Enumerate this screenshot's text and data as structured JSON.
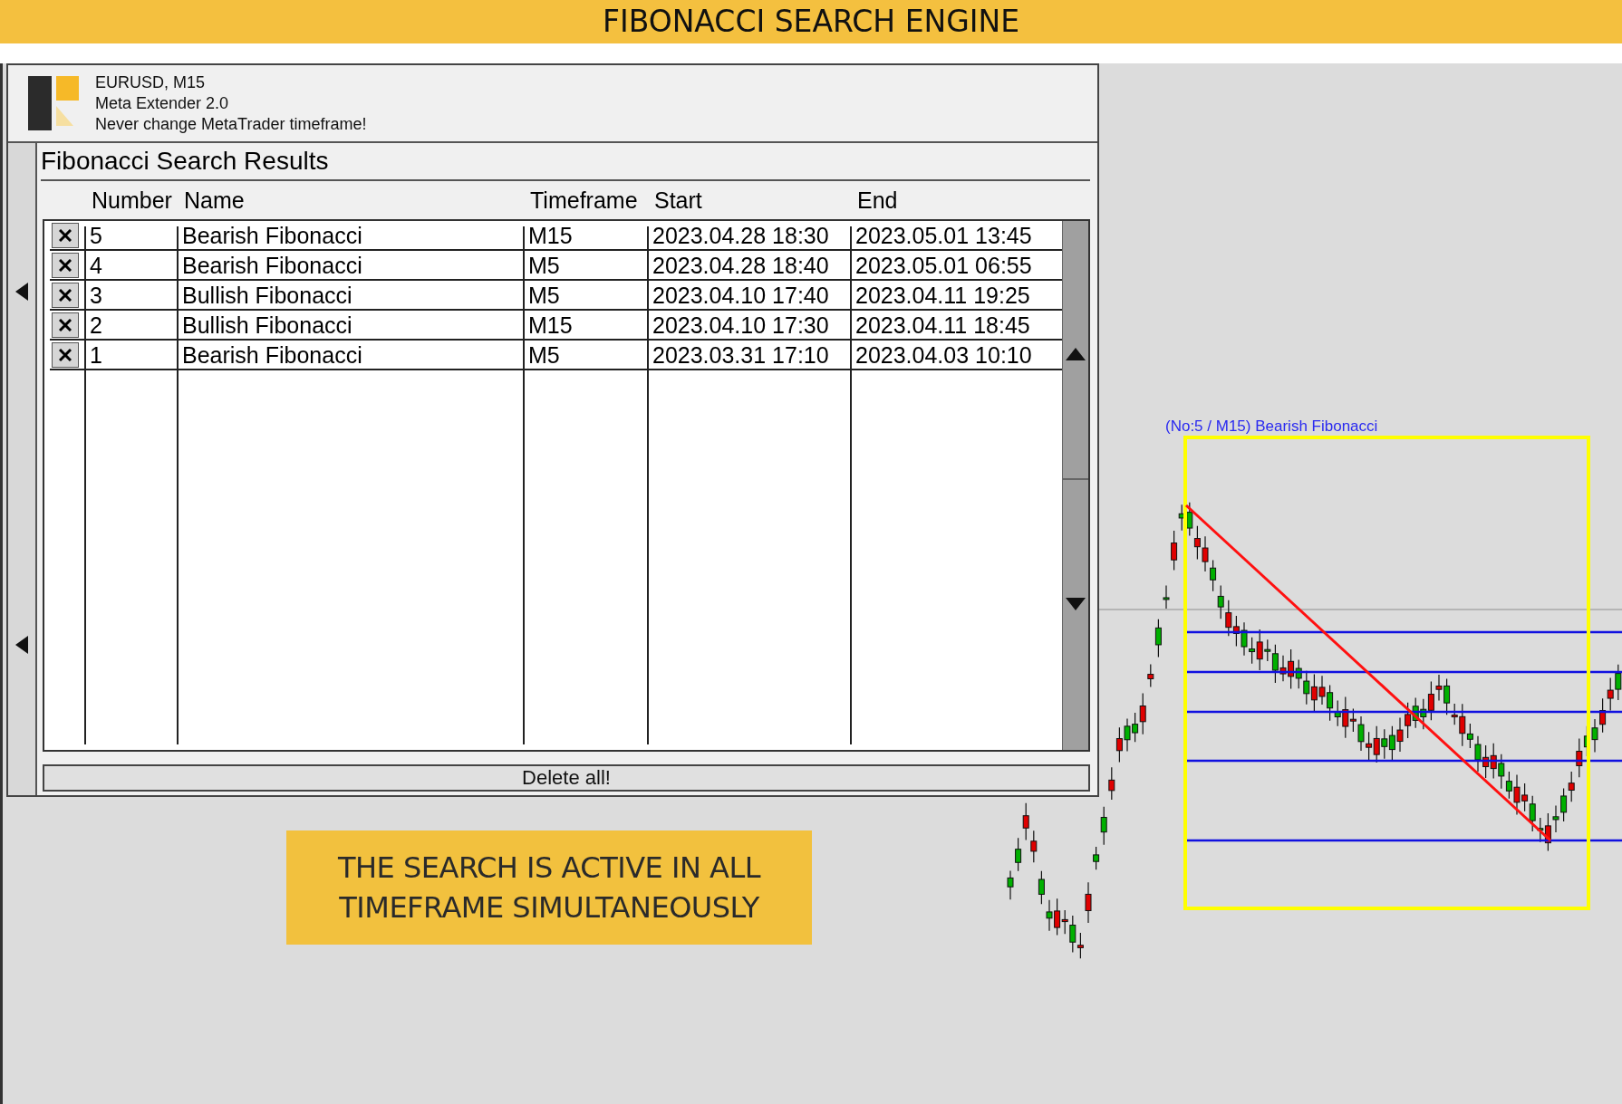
{
  "banner": {
    "title": "FIBONACCI SEARCH ENGINE"
  },
  "panel": {
    "symbol": "EURUSD, M15",
    "product": "Meta Extender 2.0",
    "notice": "Never change MetaTrader timeframe!",
    "title": "Fibonacci Search Results",
    "columns": [
      "Number",
      "Name",
      "Timeframe",
      "Start",
      "End"
    ],
    "rows": [
      {
        "number": "5",
        "name": "Bearish Fibonacci",
        "timeframe": "M15",
        "start": "2023.04.28 18:30",
        "end": "2023.05.01 13:45"
      },
      {
        "number": "4",
        "name": "Bearish Fibonacci",
        "timeframe": "M5",
        "start": "2023.04.28 18:40",
        "end": "2023.05.01 06:55"
      },
      {
        "number": "3",
        "name": "Bullish Fibonacci",
        "timeframe": "M5",
        "start": "2023.04.10 17:40",
        "end": "2023.04.11 19:25"
      },
      {
        "number": "2",
        "name": "Bullish Fibonacci",
        "timeframe": "M15",
        "start": "2023.04.10 17:30",
        "end": "2023.04.11 18:45"
      },
      {
        "number": "1",
        "name": "Bearish Fibonacci",
        "timeframe": "M5",
        "start": "2023.03.31 17:10",
        "end": "2023.04.03 10:10"
      }
    ],
    "delete_all": "Delete all!"
  },
  "chart": {
    "pattern_label": "(No:5 / M15) Bearish Fibonacci"
  },
  "callout": {
    "lines": [
      "THE SEARCH IS ACTIVE IN ALL",
      "TIMEFRAME SIMULTANEOUSLY"
    ]
  }
}
